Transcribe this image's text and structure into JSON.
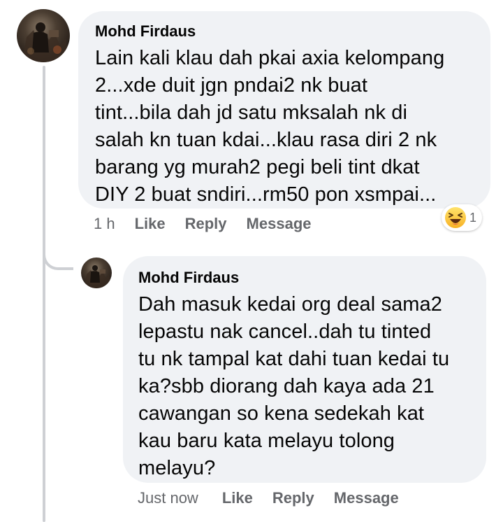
{
  "comments": [
    {
      "author": "Mohd Firdaus",
      "lines": [
        "Lain kali klau dah pkai axia kelompang",
        "2...xde duit jgn pndai2 nk buat",
        "tint...bila dah jd satu mksalah nk di",
        "salah kn tuan kdai...klau rasa diri 2 nk",
        "barang yg murah2 pegi beli tint dkat",
        "DIY 2 buat sndiri...rm50 pon xsmpai..."
      ],
      "timestamp": "1 h",
      "actions": {
        "like": "Like",
        "reply": "Reply",
        "message": "Message"
      },
      "reaction": {
        "icon": "haha-emoji-icon",
        "count": "1"
      }
    },
    {
      "author": "Mohd Firdaus",
      "lines": [
        "Dah masuk kedai org deal sama2",
        "lepastu nak cancel..dah tu tinted",
        "tu nk tampal kat dahi tuan kedai tu",
        "ka?sbb diorang dah kaya ada 21",
        "cawangan so kena sedekah kat",
        "kau baru kata melayu tolong",
        "melayu?"
      ],
      "timestamp": "Just now",
      "actions": {
        "like": "Like",
        "reply": "Reply",
        "message": "Message"
      }
    }
  ],
  "colors": {
    "bubble": "#f0f2f5",
    "text": "#050505",
    "secondary_text": "#65676b",
    "thread_line": "#ced0d4"
  }
}
